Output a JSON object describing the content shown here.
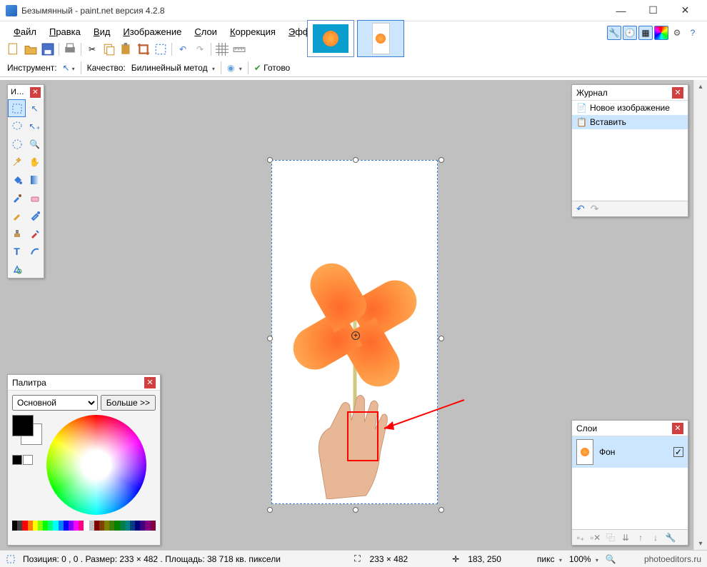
{
  "title": "Безымянный - paint.net версия 4.2.8",
  "menu": {
    "file": "Файл",
    "edit": "Правка",
    "view": "Вид",
    "image": "Изображение",
    "layers": "Слои",
    "adjust": "Коррекция",
    "effects": "Эффекты"
  },
  "toolbar2": {
    "tool_label": "Инструмент:",
    "quality_label": "Качество:",
    "quality_value": "Билинейный метод",
    "ready": "Готово"
  },
  "tools_panel_title": "И…",
  "palette": {
    "title": "Палитра",
    "primary": "Основной",
    "more": "Больше >>"
  },
  "history": {
    "title": "Журнал",
    "item1": "Новое изображение",
    "item2": "Вставить"
  },
  "layers": {
    "title": "Слои",
    "bg": "Фон"
  },
  "status": {
    "selection": "Позиция: 0 , 0 . Размер: 233  × 482 . Площадь: 38 718 кв. пиксели",
    "size": "233 × 482",
    "cursor": "183, 250",
    "unit": "пикс",
    "zoom": "100%"
  },
  "watermark": "photoeditors.ru",
  "colors": {
    "strip": [
      "#000",
      "#404040",
      "#ff0000",
      "#ff8000",
      "#ffff00",
      "#80ff00",
      "#00ff00",
      "#00ff80",
      "#00ffff",
      "#0080ff",
      "#0000ff",
      "#8000ff",
      "#ff00ff",
      "#ff0080",
      "#ffffff",
      "#c0c0c0",
      "#800000",
      "#804000",
      "#808000",
      "#408000",
      "#008000",
      "#008040",
      "#008080",
      "#004080",
      "#000080",
      "#400080",
      "#800080",
      "#800040"
    ]
  }
}
